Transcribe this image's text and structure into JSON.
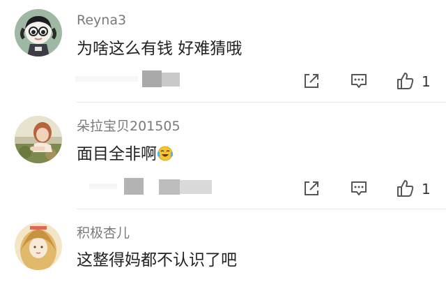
{
  "comments": [
    {
      "username": "Reyna3",
      "content": "为啥这么有钱 好难猜哦",
      "like_count": "1",
      "emoji": null
    },
    {
      "username": "朵拉宝贝201505",
      "content": "面目全非啊",
      "like_count": "1",
      "emoji": "laughing-crying-emoji"
    },
    {
      "username": "积极杏儿",
      "content": "这整得妈都不认识了吧",
      "like_count": "",
      "emoji": null
    }
  ],
  "icons": {
    "forward": "share-forward-icon",
    "comment": "reply-comment-icon",
    "like": "thumbs-up-icon"
  },
  "colors": {
    "username": "#7a7a7a",
    "content": "#222222",
    "icon": "#555555",
    "divider": "#e8e8e8"
  }
}
